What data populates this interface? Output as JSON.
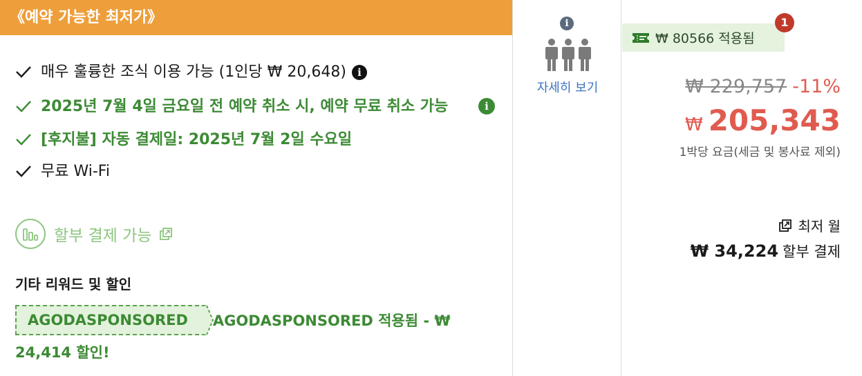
{
  "banner": {
    "title": "《예약 가능한 최저가》"
  },
  "benefits": {
    "breakfast": "매우 훌륭한 조식 이용 가능 (1인당 ₩ 20,648)",
    "cancellation": "2025년 7월 4일 금요일 전 예약 취소 시, 예약 무료 취소 가능",
    "pay_later": "[후지불] 자동 결제일: 2025년 7월 2일 수요일",
    "wifi": "무료 Wi-Fi"
  },
  "installment": {
    "label": "할부 결제 가능"
  },
  "rewards": {
    "title": "기타 리워드 및 할인",
    "coupon_code": "AGODASPONSORED",
    "coupon_text": "AGODASPONSORED 적용됨 - ₩ 24,414 할인!"
  },
  "occupancy": {
    "details_label": "자세히 보기"
  },
  "price": {
    "promo_text": "₩ 80566 적용됨",
    "promo_count": "1",
    "original": "₩ 229,757",
    "discount": "-11%",
    "currency": "₩",
    "amount": "205,343",
    "note": "1박당 요금(세금 및 봉사료 제외)",
    "lowest_monthly_label": "최저 월",
    "monthly_amount": "₩ 34,224",
    "monthly_label": "할부 결제"
  },
  "colors": {
    "banner": "#ee9e3b",
    "green": "#3c8a34",
    "light_green": "#8cc57e",
    "link_blue": "#3b73c4",
    "price_red": "#e05b4f",
    "badge_red": "#c0392b"
  },
  "icons": {
    "check": "check-icon",
    "info": "info-icon",
    "installment": "bar-chart-circle-icon",
    "external": "external-link-icon",
    "people": "people-icon",
    "ticket": "ticket-icon"
  }
}
